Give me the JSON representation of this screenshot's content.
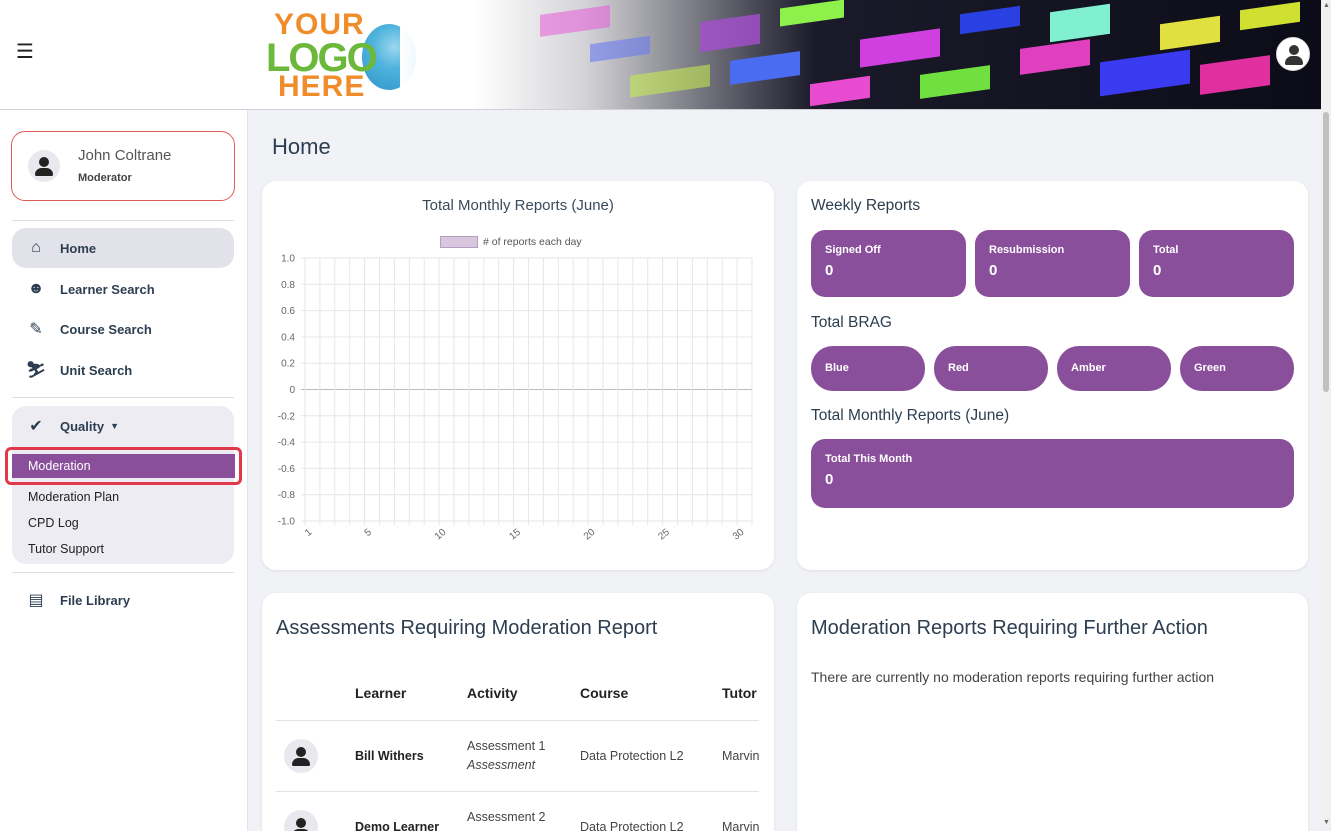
{
  "header": {
    "menu_icon": "hamburger-icon",
    "logo": {
      "line1": "YOUR",
      "line2": "LOGO",
      "line3": "HERE"
    },
    "account_icon": "user-icon"
  },
  "sidebar": {
    "user": {
      "name": "John Coltrane",
      "role": "Moderator"
    },
    "items": [
      {
        "label": "Home",
        "icon": "home-icon"
      },
      {
        "label": "Learner Search",
        "icon": "user-circle-icon"
      },
      {
        "label": "Course Search",
        "icon": "graduation-icon"
      },
      {
        "label": "Unit Search",
        "icon": "skier-icon"
      }
    ],
    "quality": {
      "label": "Quality",
      "icon": "check-circle-icon",
      "subitems": [
        "Moderation",
        "Moderation Plan",
        "CPD Log",
        "Tutor Support"
      ]
    },
    "file_library": {
      "label": "File Library",
      "icon": "books-icon"
    }
  },
  "main": {
    "title": "Home",
    "weekly": {
      "title": "Weekly Reports",
      "tiles": [
        {
          "label": "Signed Off",
          "value": "0"
        },
        {
          "label": "Resubmission",
          "value": "0"
        },
        {
          "label": "Total",
          "value": "0"
        }
      ],
      "brag_title": "Total BRAG",
      "brag": [
        "Blue",
        "Red",
        "Amber",
        "Green"
      ],
      "monthly_title": "Total Monthly Reports (June)",
      "monthly_tile": {
        "label": "Total This Month",
        "value": "0"
      }
    },
    "assessments": {
      "title": "Assessments Requiring Moderation Report",
      "columns": [
        "Learner",
        "Activity",
        "Course",
        "Tutor"
      ],
      "rows": [
        {
          "learner": "Bill Withers",
          "activity": "Assessment 1",
          "activity_type": "Assessment",
          "course": "Data Protection L2",
          "tutor": "Marvin"
        },
        {
          "learner": "Demo Learner",
          "activity": "Assessment 2",
          "activity_type": "",
          "course": "Data Protection L2",
          "tutor": "Marvin"
        }
      ]
    },
    "moderation": {
      "title": "Moderation Reports Requiring Further Action",
      "message": "There are currently no moderation reports requiring further action"
    }
  },
  "chart_data": {
    "type": "bar",
    "title": "Total Monthly Reports (June)",
    "categories": [
      "1",
      "2",
      "3",
      "4",
      "5",
      "6",
      "7",
      "8",
      "9",
      "10",
      "11",
      "12",
      "13",
      "14",
      "15",
      "16",
      "17",
      "18",
      "19",
      "20",
      "21",
      "22",
      "23",
      "24",
      "25",
      "26",
      "27",
      "28",
      "29",
      "30"
    ],
    "series": [
      {
        "name": "# of reports each day",
        "values": [
          0,
          0,
          0,
          0,
          0,
          0,
          0,
          0,
          0,
          0,
          0,
          0,
          0,
          0,
          0,
          0,
          0,
          0,
          0,
          0,
          0,
          0,
          0,
          0,
          0,
          0,
          0,
          0,
          0,
          0
        ],
        "color": "#d9c7df"
      }
    ],
    "x_tick_labels": [
      "1",
      "5",
      "10",
      "15",
      "20",
      "25",
      "30"
    ],
    "y_ticks": [
      "1.0",
      "0.8",
      "0.6",
      "0.4",
      "0.2",
      "0",
      "-0.2",
      "-0.4",
      "-0.6",
      "-0.8",
      "-1.0"
    ],
    "ylim": [
      -1.0,
      1.0
    ],
    "grid": true,
    "legend": "top"
  },
  "colors": {
    "accent": "#8a4f9b",
    "highlight": "#e03a4a"
  }
}
